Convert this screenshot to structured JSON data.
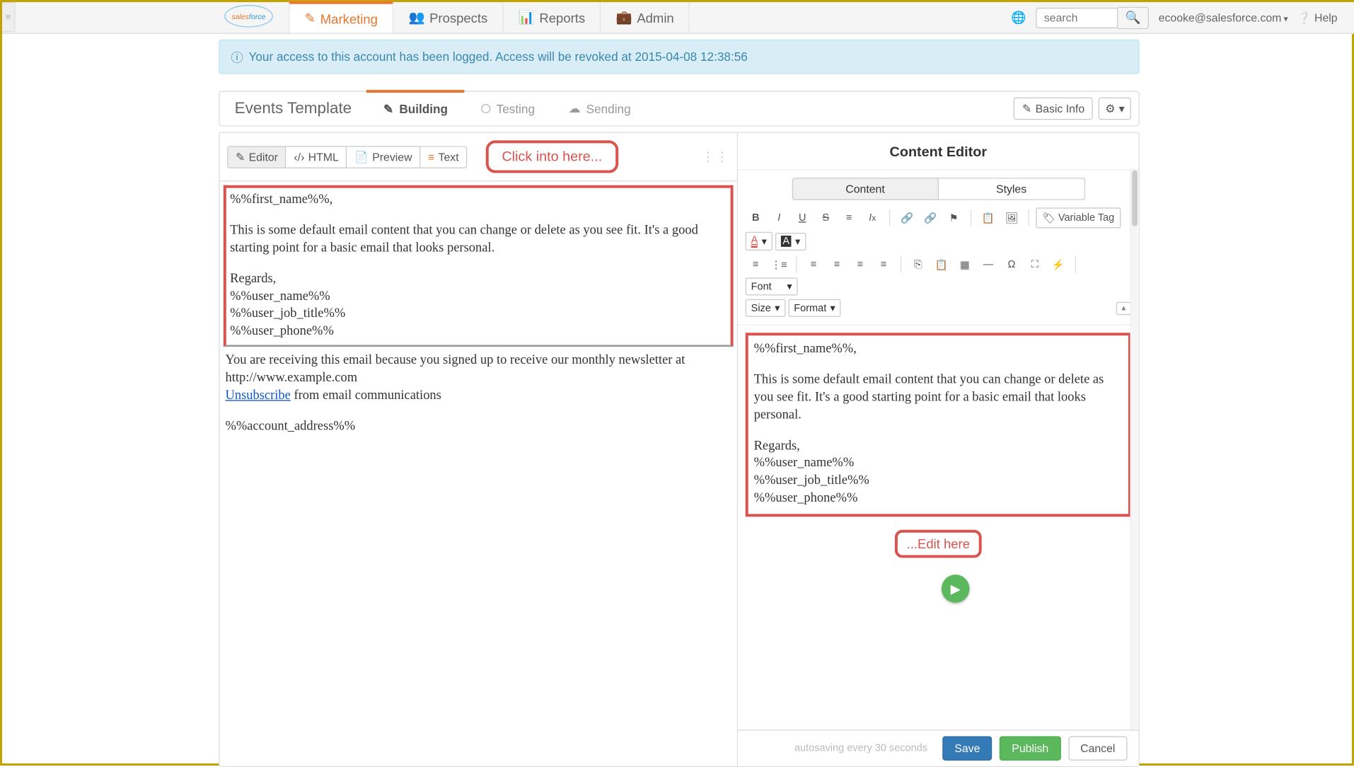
{
  "nav": {
    "marketing": "Marketing",
    "prospects": "Prospects",
    "reports": "Reports",
    "admin": "Admin",
    "search_placeholder": "search",
    "user": "ecooke@salesforce.com",
    "help": "Help"
  },
  "alert": "Your access to this account has been logged. Access will be revoked at 2015-04-08 12:38:56",
  "page": {
    "title": "Events Template",
    "step_building": "Building",
    "step_testing": "Testing",
    "step_sending": "Sending",
    "basic_info": "Basic Info"
  },
  "left_tabs": {
    "editor": "Editor",
    "html": "HTML",
    "preview": "Preview",
    "text": "Text"
  },
  "callouts": {
    "click_into": "Click into here...",
    "edit_here": "...Edit here"
  },
  "email": {
    "greeting": "%%first_name%%,",
    "body": "This is some default email content that you can change or delete as you see fit. It's a good starting point for a basic email that looks personal.",
    "regards": "Regards,",
    "user_name": "%%user_name%%",
    "user_job": "%%user_job_title%%",
    "user_phone": "%%user_phone%%",
    "footer1": "You are receiving this email because you signed up to receive our monthly newsletter at http://www.example.com",
    "unsubscribe": "Unsubscribe",
    "footer2": " from email communications",
    "account_addr": "%%account_address%%"
  },
  "right": {
    "title": "Content Editor",
    "content_tab": "Content",
    "styles_tab": "Styles",
    "variable_tag": "Variable Tag",
    "size": "Size",
    "format": "Format",
    "font": "Font"
  },
  "footer": {
    "autosave": "autosaving every 30 seconds",
    "save": "Save",
    "publish": "Publish",
    "cancel": "Cancel"
  }
}
